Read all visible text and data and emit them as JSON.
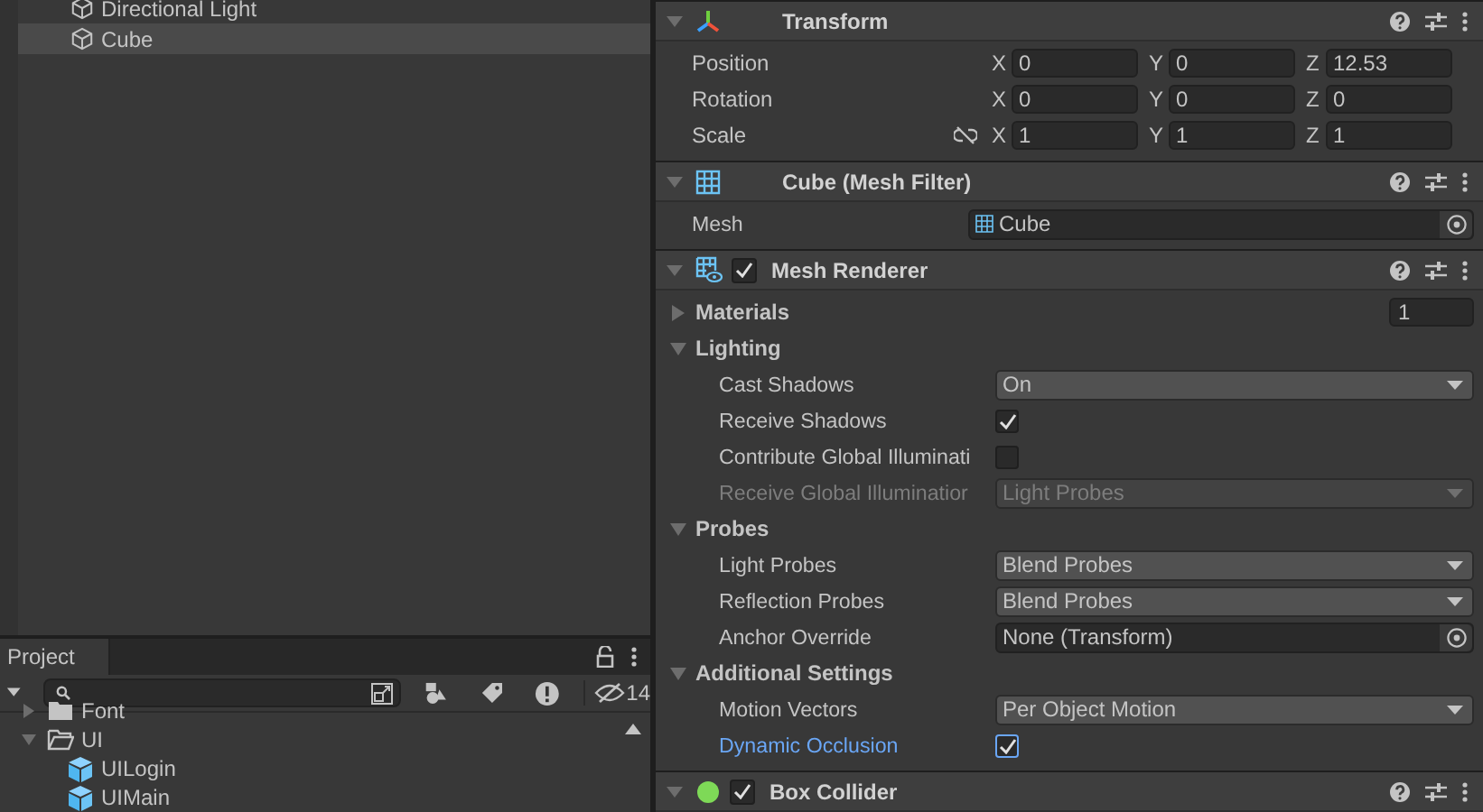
{
  "hierarchy": {
    "items": [
      {
        "name": "Directional Light",
        "selected": false
      },
      {
        "name": "Cube",
        "selected": true
      }
    ]
  },
  "project": {
    "tab": "Project",
    "hidden_count": "14",
    "tree": [
      {
        "name": "Font",
        "kind": "folder",
        "expanded": false
      },
      {
        "name": "UI",
        "kind": "folder",
        "expanded": true,
        "children": [
          {
            "name": "UILogin",
            "kind": "prefab"
          },
          {
            "name": "UIMain",
            "kind": "prefab"
          }
        ]
      }
    ]
  },
  "inspector": {
    "components": [
      {
        "kind": "transform",
        "title": "Transform",
        "expanded": true,
        "rows": [
          {
            "label": "Position",
            "proportional": null,
            "values": [
              {
                "axis": "X",
                "value": "0"
              },
              {
                "axis": "Y",
                "value": "0"
              },
              {
                "axis": "Z",
                "value": "12.53"
              }
            ]
          },
          {
            "label": "Rotation",
            "proportional": null,
            "values": [
              {
                "axis": "X",
                "value": "0"
              },
              {
                "axis": "Y",
                "value": "0"
              },
              {
                "axis": "Z",
                "value": "0"
              }
            ]
          },
          {
            "label": "Scale",
            "proportional": false,
            "values": [
              {
                "axis": "X",
                "value": "1"
              },
              {
                "axis": "Y",
                "value": "1"
              },
              {
                "axis": "Z",
                "value": "1"
              }
            ]
          }
        ]
      },
      {
        "kind": "meshfilter",
        "title": "Cube (Mesh Filter)",
        "expanded": true,
        "rows": [
          {
            "kind": "object",
            "label": "Mesh",
            "value": "Cube",
            "modified": false
          }
        ]
      },
      {
        "kind": "renderer",
        "title": "Mesh Renderer",
        "expanded": true,
        "enabled": true,
        "rows": [
          {
            "kind": "foldout",
            "label": "Materials",
            "expanded": false,
            "value": "1"
          },
          {
            "kind": "section",
            "label": "Lighting",
            "expanded": true
          },
          {
            "kind": "dropdown",
            "label": "Cast Shadows",
            "value": "On",
            "disabled": false,
            "modified": false
          },
          {
            "kind": "checkbox",
            "label": "Receive Shadows",
            "checked": true,
            "disabled": false,
            "modified": false
          },
          {
            "kind": "checkbox",
            "label": "Contribute Global Illuminati",
            "checked": false,
            "disabled": false,
            "modified": false
          },
          {
            "kind": "dropdown",
            "label": "Receive Global Illuminatior",
            "value": "Light Probes",
            "disabled": true,
            "modified": false
          },
          {
            "kind": "section",
            "label": "Probes",
            "expanded": true
          },
          {
            "kind": "dropdown",
            "label": "Light Probes",
            "value": "Blend Probes",
            "disabled": false,
            "modified": false
          },
          {
            "kind": "dropdown",
            "label": "Reflection Probes",
            "value": "Blend Probes",
            "disabled": false,
            "modified": false
          },
          {
            "kind": "object",
            "label": "Anchor Override",
            "value": "None (Transform)",
            "modified": false
          },
          {
            "kind": "section",
            "label": "Additional Settings",
            "expanded": true
          },
          {
            "kind": "dropdown",
            "label": "Motion Vectors",
            "value": "Per Object Motion",
            "disabled": false,
            "modified": false
          },
          {
            "kind": "checkbox",
            "label": "Dynamic Occlusion",
            "checked": true,
            "disabled": false,
            "modified": true
          }
        ]
      },
      {
        "kind": "collider",
        "title": "Box Collider",
        "expanded": true,
        "enabled": true
      }
    ]
  }
}
